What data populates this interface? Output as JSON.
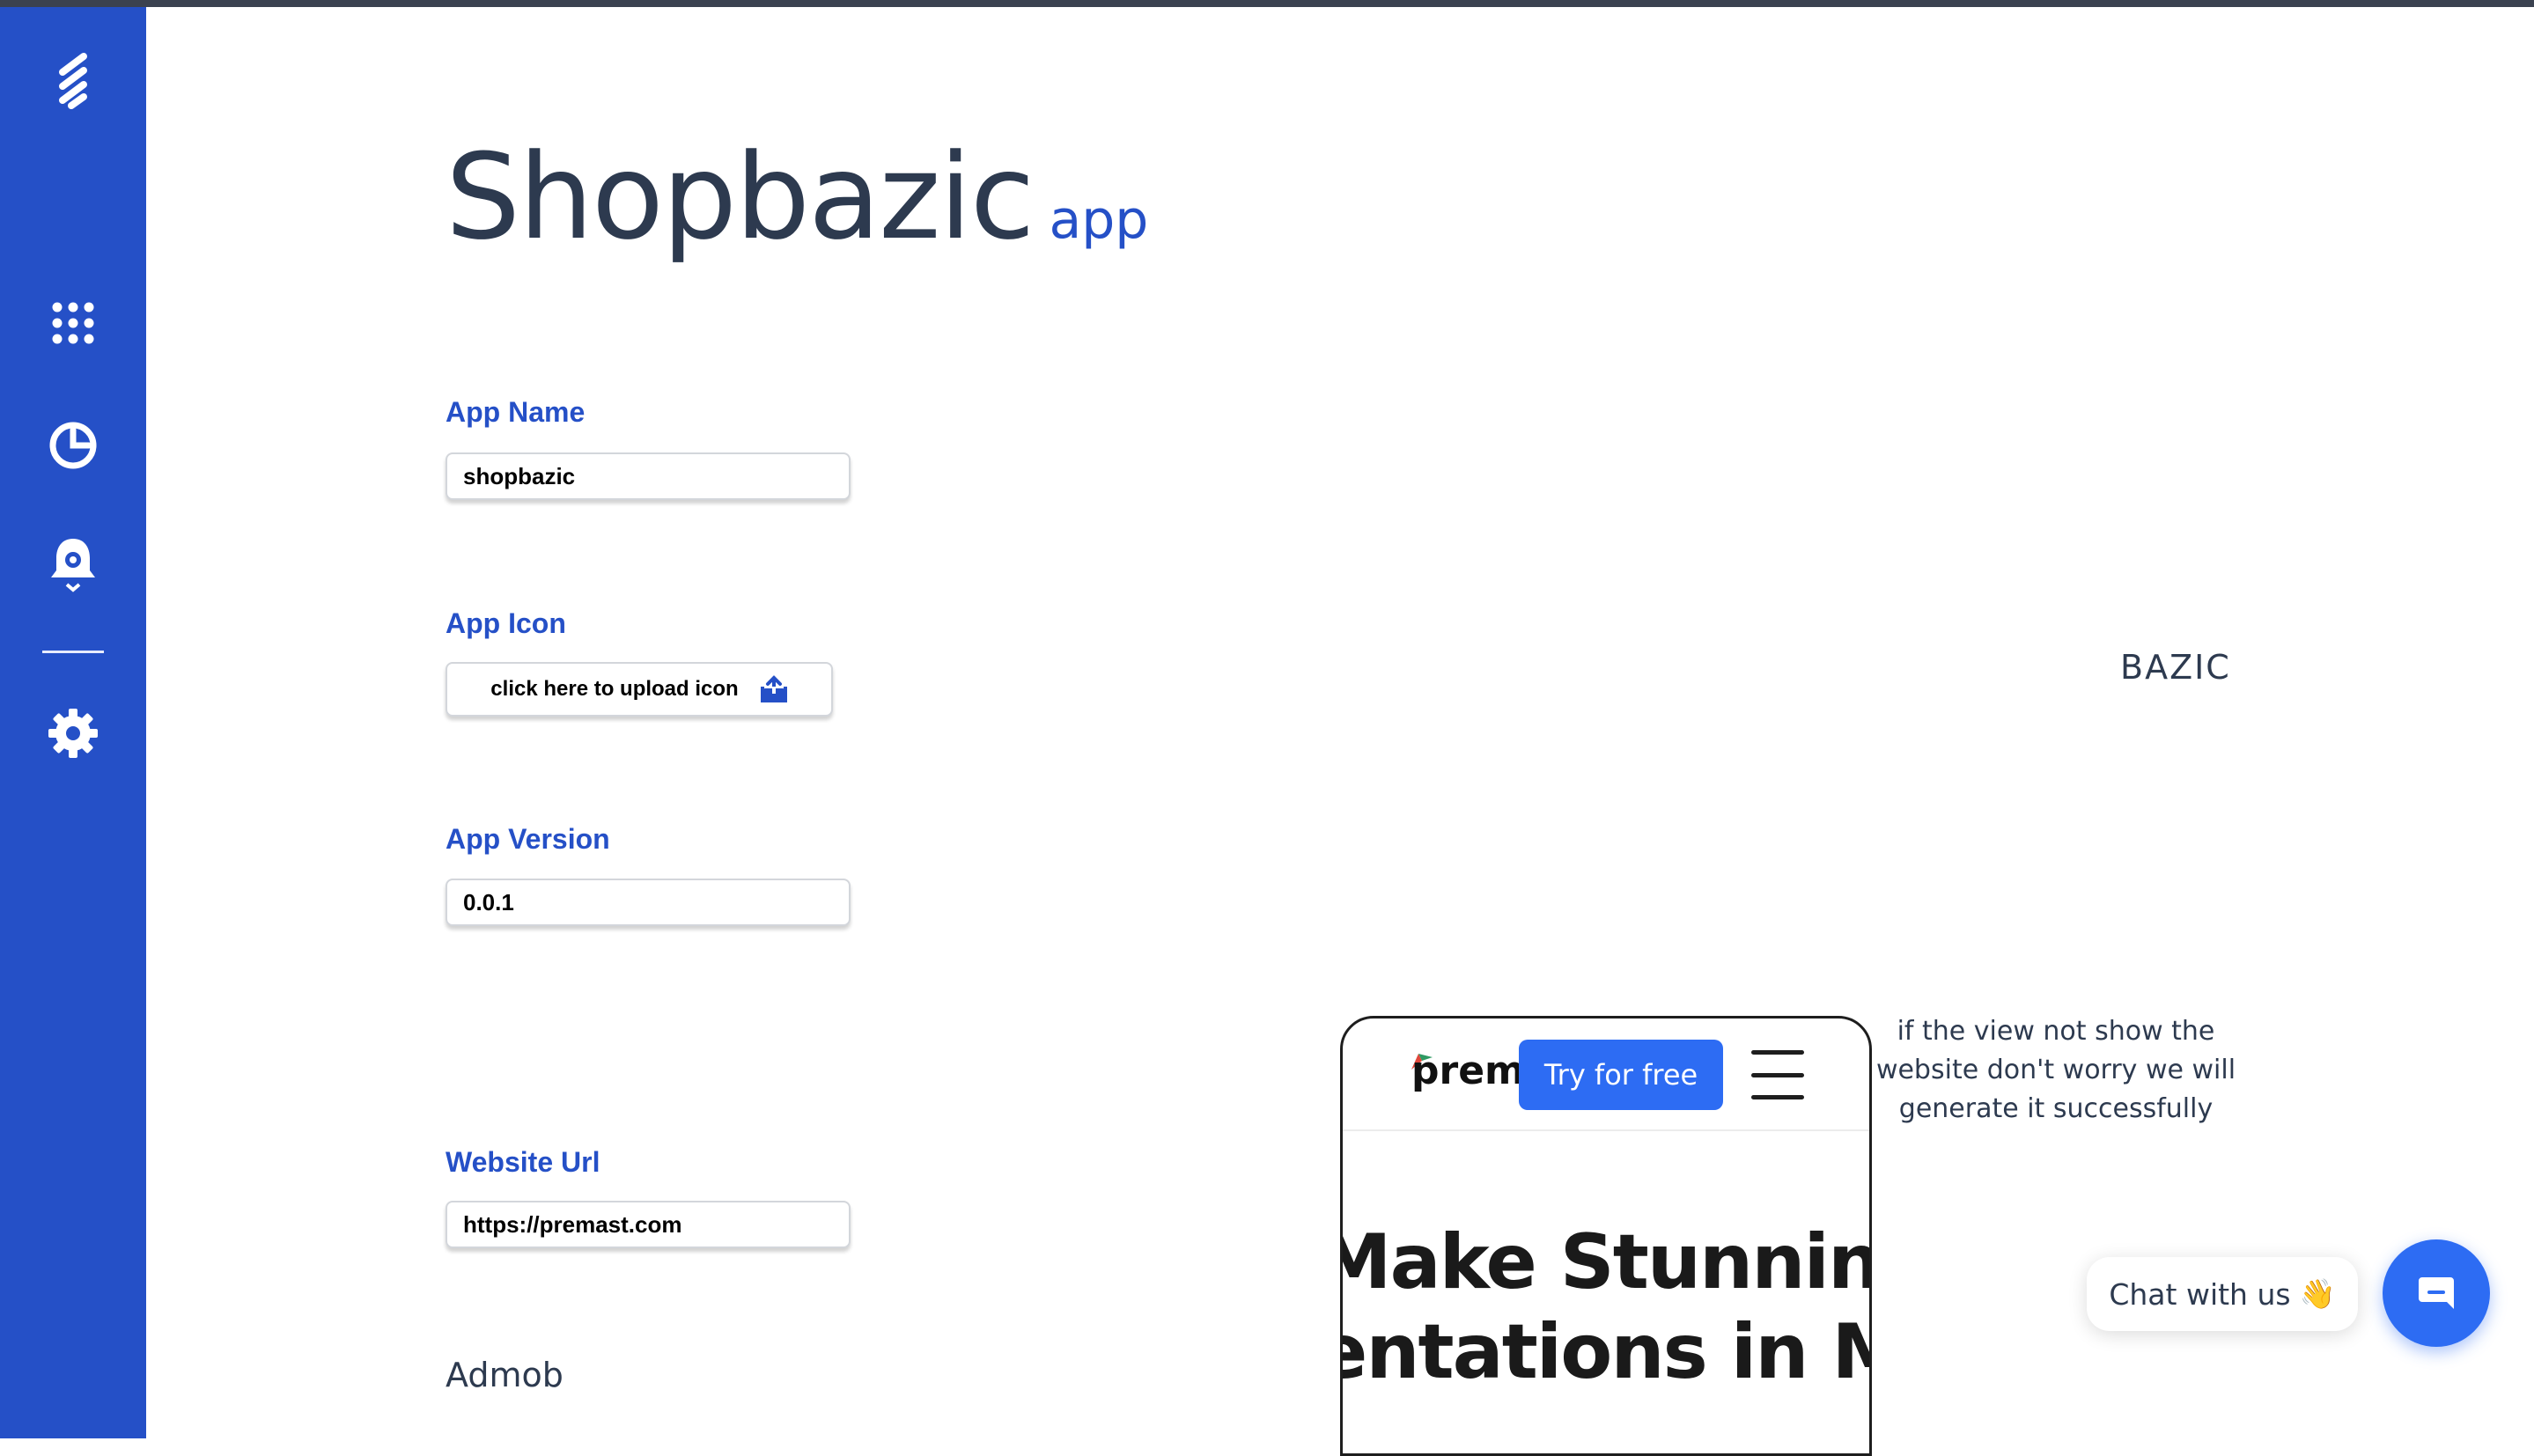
{
  "app": {
    "title": "Shopbazic",
    "title_suffix": "app"
  },
  "sidebar": {
    "items": [
      {
        "name": "logo",
        "icon": "stacked-bars-logo-icon"
      },
      {
        "name": "apps",
        "icon": "grid-dots-icon"
      },
      {
        "name": "analytics",
        "icon": "pie-chart-icon"
      },
      {
        "name": "notifications",
        "icon": "bell-icon"
      },
      {
        "name": "settings",
        "icon": "gear-icon"
      }
    ],
    "color": "#2550c7"
  },
  "form": {
    "app_name": {
      "label": "App Name",
      "value": "shopbazic"
    },
    "app_icon": {
      "label": "App Icon",
      "button_label": "click here to upload icon",
      "icon": "upload-icon"
    },
    "app_version": {
      "label": "App Version",
      "value": "0.0.1"
    },
    "website_url": {
      "label": "Website Url",
      "value": "https://premast.com"
    },
    "admob": {
      "label": "Admob"
    }
  },
  "preview": {
    "brand": "BAZIC",
    "note": "if the view not show the website don't worry we will generate it successfully",
    "phone": {
      "logo_text": "prem",
      "cta": "Try for free",
      "hero_line1": "Make Stunning",
      "hero_line2": "entations in Mi"
    }
  },
  "chat": {
    "label": "Chat with us",
    "emoji": "👋",
    "fab_icon": "chat-bubble-icon",
    "accent": "#2d6cf3"
  }
}
